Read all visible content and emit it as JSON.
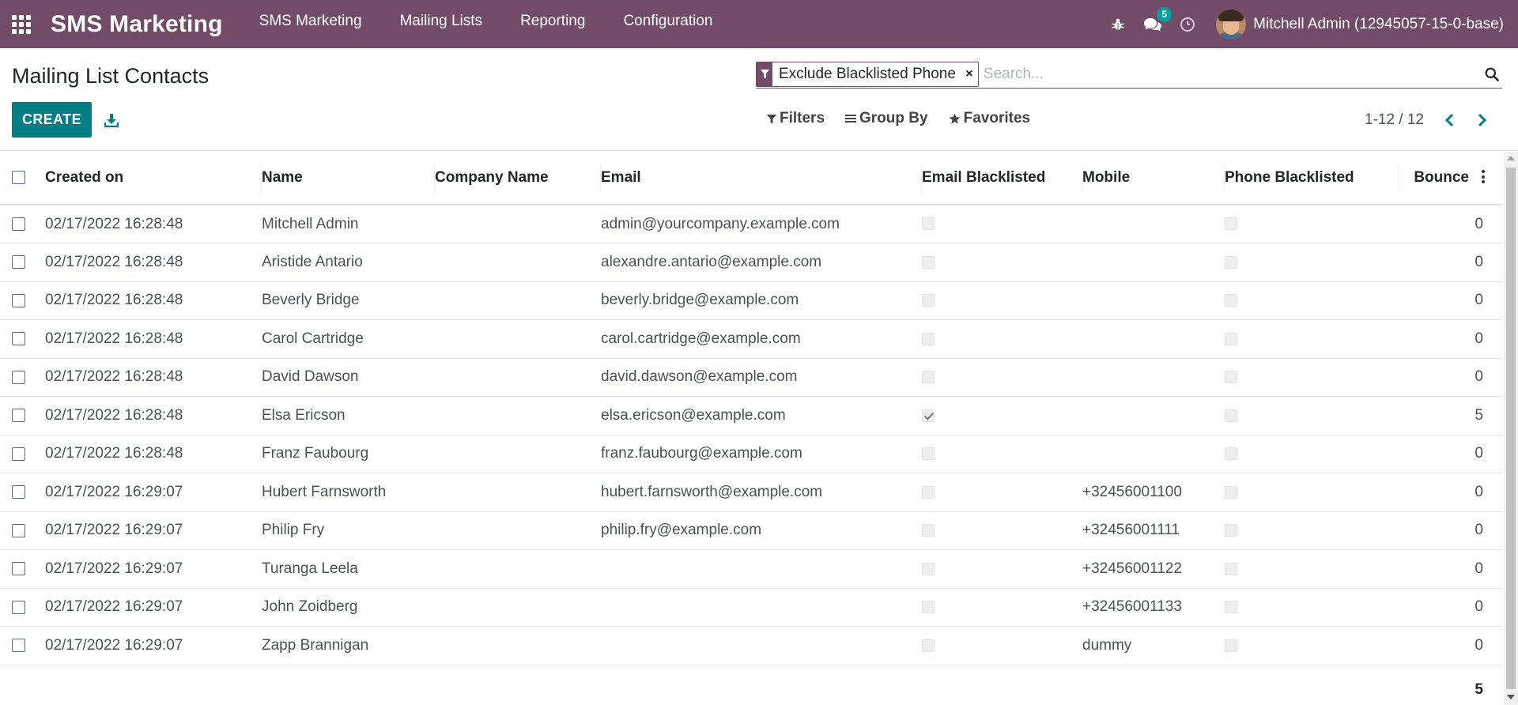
{
  "navbar": {
    "brand": "SMS Marketing",
    "menu": [
      "SMS Marketing",
      "Mailing Lists",
      "Reporting",
      "Configuration"
    ],
    "messages_badge": "5",
    "user_name": "Mitchell Admin (12945057-15-0-base)"
  },
  "control_panel": {
    "title": "Mailing List Contacts",
    "create_label": "CREATE",
    "facet_label": "Exclude Blacklisted Phone",
    "search_placeholder": "Search...",
    "filters_label": "Filters",
    "group_by_label": "Group By",
    "favorites_label": "Favorites",
    "pager_value": "1-12 / 12"
  },
  "table": {
    "headers": {
      "created_on": "Created on",
      "name": "Name",
      "company_name": "Company Name",
      "email": "Email",
      "email_blacklisted": "Email Blacklisted",
      "mobile": "Mobile",
      "phone_blacklisted": "Phone Blacklisted",
      "bounce": "Bounce"
    },
    "rows": [
      {
        "created_on": "02/17/2022 16:28:48",
        "name": "Mitchell Admin",
        "company_name": "",
        "email": "admin@yourcompany.example.com",
        "email_blacklisted": false,
        "mobile": "",
        "phone_blacklisted": false,
        "bounce": "0"
      },
      {
        "created_on": "02/17/2022 16:28:48",
        "name": "Aristide Antario",
        "company_name": "",
        "email": "alexandre.antario@example.com",
        "email_blacklisted": false,
        "mobile": "",
        "phone_blacklisted": false,
        "bounce": "0"
      },
      {
        "created_on": "02/17/2022 16:28:48",
        "name": "Beverly Bridge",
        "company_name": "",
        "email": "beverly.bridge@example.com",
        "email_blacklisted": false,
        "mobile": "",
        "phone_blacklisted": false,
        "bounce": "0"
      },
      {
        "created_on": "02/17/2022 16:28:48",
        "name": "Carol Cartridge",
        "company_name": "",
        "email": "carol.cartridge@example.com",
        "email_blacklisted": false,
        "mobile": "",
        "phone_blacklisted": false,
        "bounce": "0"
      },
      {
        "created_on": "02/17/2022 16:28:48",
        "name": "David Dawson",
        "company_name": "",
        "email": "david.dawson@example.com",
        "email_blacklisted": false,
        "mobile": "",
        "phone_blacklisted": false,
        "bounce": "0"
      },
      {
        "created_on": "02/17/2022 16:28:48",
        "name": "Elsa Ericson",
        "company_name": "",
        "email": "elsa.ericson@example.com",
        "email_blacklisted": true,
        "mobile": "",
        "phone_blacklisted": false,
        "bounce": "5"
      },
      {
        "created_on": "02/17/2022 16:28:48",
        "name": "Franz Faubourg",
        "company_name": "",
        "email": "franz.faubourg@example.com",
        "email_blacklisted": false,
        "mobile": "",
        "phone_blacklisted": false,
        "bounce": "0"
      },
      {
        "created_on": "02/17/2022 16:29:07",
        "name": "Hubert Farnsworth",
        "company_name": "",
        "email": "hubert.farnsworth@example.com",
        "email_blacklisted": false,
        "mobile": "+32456001100",
        "phone_blacklisted": false,
        "bounce": "0"
      },
      {
        "created_on": "02/17/2022 16:29:07",
        "name": "Philip Fry",
        "company_name": "",
        "email": "philip.fry@example.com",
        "email_blacklisted": false,
        "mobile": "+32456001111",
        "phone_blacklisted": false,
        "bounce": "0"
      },
      {
        "created_on": "02/17/2022 16:29:07",
        "name": "Turanga Leela",
        "company_name": "",
        "email": "",
        "email_blacklisted": false,
        "mobile": "+32456001122",
        "phone_blacklisted": false,
        "bounce": "0"
      },
      {
        "created_on": "02/17/2022 16:29:07",
        "name": "John Zoidberg",
        "company_name": "",
        "email": "",
        "email_blacklisted": false,
        "mobile": "+32456001133",
        "phone_blacklisted": false,
        "bounce": "0"
      },
      {
        "created_on": "02/17/2022 16:29:07",
        "name": "Zapp Brannigan",
        "company_name": "",
        "email": "",
        "email_blacklisted": false,
        "mobile": "dummy",
        "phone_blacklisted": false,
        "bounce": "0"
      }
    ],
    "footer_bounce_total": "5"
  },
  "colors": {
    "navbar": "#714b67",
    "primary_button": "#017e84",
    "pager_arrows": "#017e84",
    "badge": "#00a09d"
  },
  "icons": [
    "apps-grid-icon",
    "bug-icon",
    "chat-icon",
    "clock-icon",
    "download-icon",
    "filter-icon",
    "close-icon",
    "search-icon",
    "bars-icon",
    "star-icon",
    "chevron-left-icon",
    "chevron-right-icon",
    "kebab-icon"
  ]
}
